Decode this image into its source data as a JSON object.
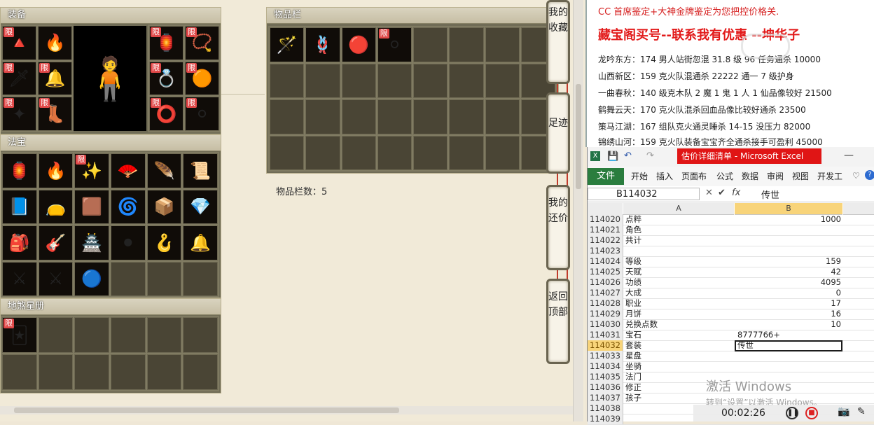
{
  "game": {
    "equip_title": "装备",
    "fabao_title": "法宝",
    "xingce_title": "地煞星册",
    "inventory_title": "物品栏",
    "inventory_count_label": "物品栏数：5",
    "limit_badge": "限",
    "side_buttons": {
      "favorites": "我的收藏",
      "footprint": "足迹",
      "my_offers": "我的还价",
      "back_top": "返回顶部"
    }
  },
  "doc": {
    "heading1": "CC 首席鉴定+大神金牌鉴定为您把控价格关.",
    "heading2": "藏宝阁买号--联系我有优惠 --坤华子",
    "lines": [
      "龙吟东方：174 男人站街忽混 31.8 级 96 任务通杀 10000",
      "山西新区：159 克火队混通杀 22222 通一 7 级护身",
      "一曲春秋：140 级克木队 2 魔 1 鬼 1 人 1 仙品像较好 21500",
      "鹤舞云天：170 克火队混杀回血品像比较好通杀 23500",
      "策马江湖：167 组队克火通灵睡杀 14-15 没压力 82000",
      "锦绣山河：159 克火队装备宝宝齐全通杀接手可盈利 45000"
    ]
  },
  "excel": {
    "window_title": "估价详细清单 - Microsoft Excel",
    "ribbon_file": "文件",
    "ribbon_tabs": [
      "开始",
      "插入",
      "页面布",
      "公式",
      "数据",
      "审阅",
      "视图",
      "开发工"
    ],
    "name_box": "B114032",
    "formula_value": "传世",
    "col_a": "A",
    "col_b": "B",
    "rows": [
      {
        "n": "114020",
        "a": "点粹",
        "b": "1000"
      },
      {
        "n": "114021",
        "a": "角色",
        "b": ""
      },
      {
        "n": "114022",
        "a": "共计",
        "b": ""
      },
      {
        "n": "114023",
        "a": "",
        "b": ""
      },
      {
        "n": "114024",
        "a": "等级",
        "b": "159"
      },
      {
        "n": "114025",
        "a": "天赋",
        "b": "42"
      },
      {
        "n": "114026",
        "a": "功绩",
        "b": "4095"
      },
      {
        "n": "114027",
        "a": "大成",
        "b": "0"
      },
      {
        "n": "114028",
        "a": "职业",
        "b": "17"
      },
      {
        "n": "114029",
        "a": "月饼",
        "b": "16"
      },
      {
        "n": "114030",
        "a": "兑换点数",
        "b": "10"
      },
      {
        "n": "114031",
        "a": "宝石",
        "b": "8777766+"
      },
      {
        "n": "114032",
        "a": "套装",
        "b": "传世"
      },
      {
        "n": "114033",
        "a": "星盘",
        "b": ""
      },
      {
        "n": "114034",
        "a": "坐骑",
        "b": ""
      },
      {
        "n": "114035",
        "a": "法门",
        "b": ""
      },
      {
        "n": "114036",
        "a": "修正",
        "b": ""
      },
      {
        "n": "114037",
        "a": "孩子",
        "b": ""
      },
      {
        "n": "114038",
        "a": "",
        "b": ""
      },
      {
        "n": "114039",
        "a": "",
        "b": ""
      }
    ]
  },
  "overlay": {
    "activate_windows": "激活 Windows",
    "activate_hint": "转到“设置”以激活 Windows。",
    "timer": "00:02:26"
  }
}
